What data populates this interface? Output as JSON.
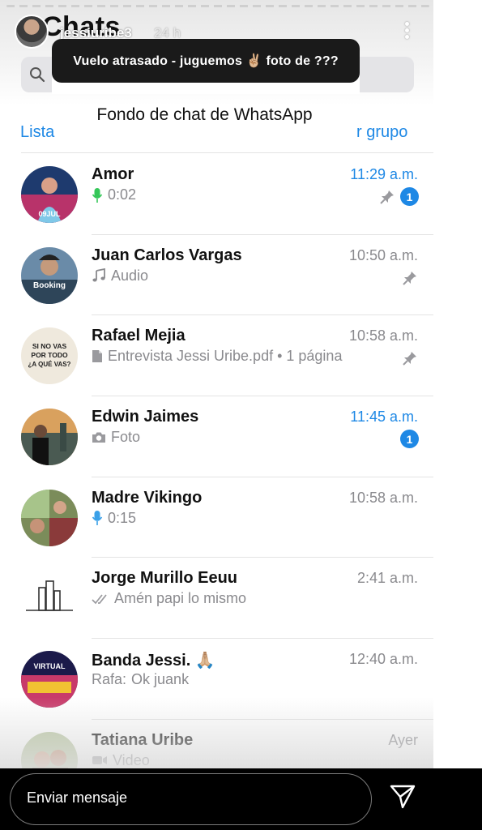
{
  "story": {
    "username": "jessiuribe3",
    "time_ago": "24 h",
    "caption": "Vuelo atrasado - juguemos ✌🏼 foto de ???",
    "reply_placeholder": "Enviar mensaje"
  },
  "whatsapp": {
    "title": "Chats",
    "subtitle": "Fondo de chat de WhatsApp",
    "edit_left": "Lista",
    "edit_right": "r grupo",
    "accent_color": "#1e88e5",
    "chats": [
      {
        "name": "Amor",
        "time": "11:29 a.m.",
        "preview": "0:02",
        "icon": "microphone-icon",
        "pinned": true,
        "unread": "1"
      },
      {
        "name": "Juan Carlos Vargas",
        "time": "10:50 a.m.",
        "preview": "Audio",
        "icon": "music-note-icon",
        "pinned": true
      },
      {
        "name": "Rafael Mejia",
        "time": "10:58 a.m.",
        "preview": "Entrevista Jessi Uribe.pdf • 1 página",
        "icon": "document-icon",
        "pinned": true
      },
      {
        "name": "Edwin Jaimes",
        "time": "11:45 a.m.",
        "preview": "Foto",
        "icon": "camera-icon",
        "unread": "1"
      },
      {
        "name": "Madre Vikingo",
        "time": "10:58 a.m.",
        "preview": "0:15",
        "icon": "microphone-icon"
      },
      {
        "name": "Jorge Murillo Eeuu",
        "time": "2:41 a.m.",
        "preview": "Amén papi lo mismo",
        "icon": "double-check-icon"
      },
      {
        "name": "Banda Jessi. 🙏🏼",
        "time": "12:40 a.m.",
        "sender": "Rafa:",
        "preview": "Ok juank"
      },
      {
        "name": "Tatiana Uribe",
        "time": "Ayer",
        "preview": "Video",
        "icon": "video-icon"
      }
    ]
  },
  "avatar_labels": {
    "amor": "09JUL",
    "juan": "Booking",
    "rafael": [
      "SI NO VAS",
      "POR TODO",
      "¿A QUÉ VAS?"
    ],
    "banda": "VIRTUAL"
  }
}
